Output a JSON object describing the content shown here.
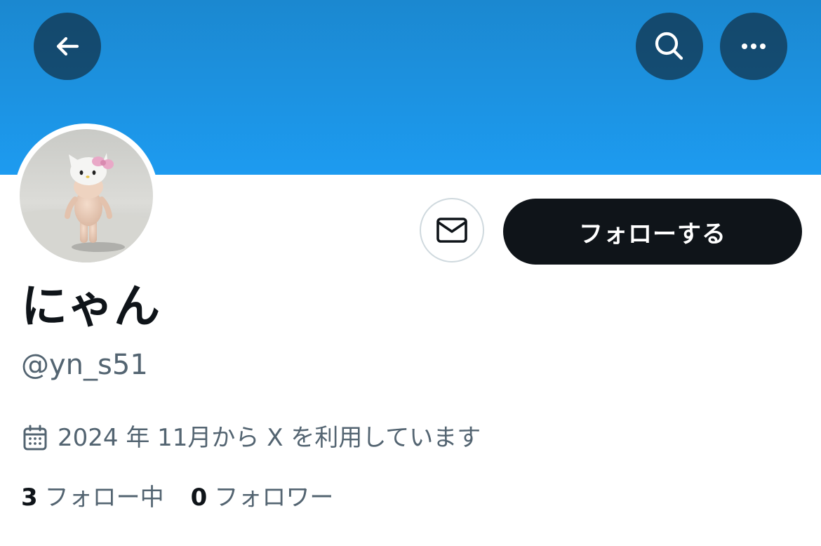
{
  "header": {
    "back_icon": "arrow-left-icon",
    "search_icon": "search-icon",
    "more_icon": "more-horizontal-icon",
    "banner_color": "#1d9bf0"
  },
  "profile": {
    "display_name": "にゃん",
    "handle": "@yn_s51",
    "joined_icon": "calendar-icon",
    "joined_text": "2024 年 11月から X を利用しています",
    "avatar_description": "photo-avatar"
  },
  "actions": {
    "message_icon": "mail-icon",
    "follow_label": "フォローする"
  },
  "stats": {
    "following_count": "3",
    "following_label": "フォロー中",
    "followers_count": "0",
    "followers_label": "フォロワー"
  },
  "colors": {
    "primary_text": "#0f1419",
    "secondary_text": "#536471",
    "follow_button_bg": "#0f1419",
    "border": "#cfd9de"
  }
}
